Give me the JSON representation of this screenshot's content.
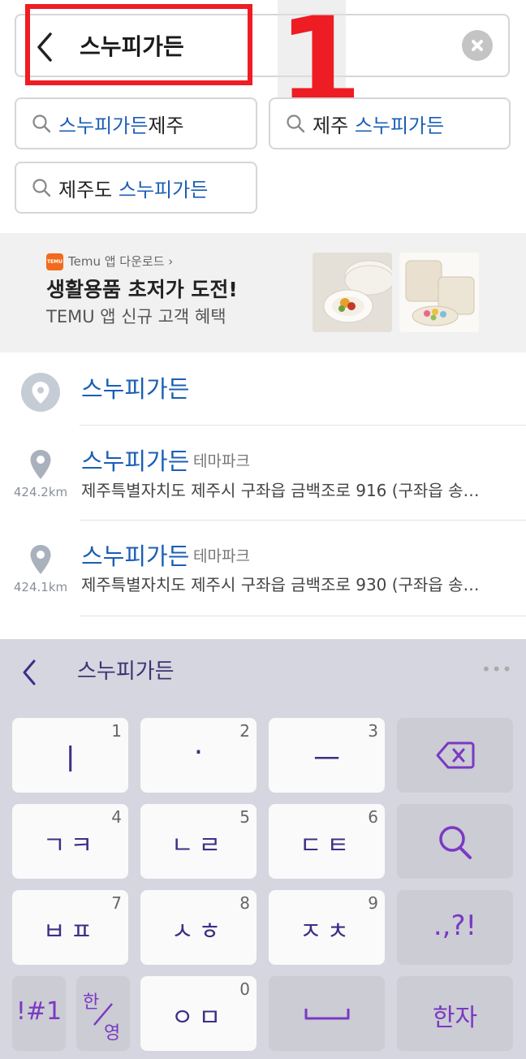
{
  "search": {
    "query": "스누피가든"
  },
  "annotation": {
    "number": "1"
  },
  "suggestions": [
    {
      "highlight": "스누피가든",
      "plain": "제주",
      "order": "hl-first"
    },
    {
      "plain": "제주",
      "highlight": "스누피가든",
      "order": "pl-first"
    },
    {
      "plain": "제주도",
      "highlight": "스누피가든",
      "order": "pl-first"
    }
  ],
  "ad": {
    "brand_link": "Temu 앱 다운로드 ›",
    "logo_text": "TEMU",
    "title": "생활용품 초저가 도전!",
    "subtitle": "TEMU 앱 신규 고객 혜택"
  },
  "results": [
    {
      "title": "스누피가든",
      "category": "",
      "address": "",
      "distance": ""
    },
    {
      "title": "스누피가든",
      "category": "테마파크",
      "address": "제주특별자치도 제주시 구좌읍 금백조로 916 (구좌읍 송…",
      "distance": "424.2km"
    },
    {
      "title": "스누피가든",
      "category": "테마파크",
      "address": "제주특별자치도 제주시 구좌읍 금백조로 930 (구좌읍 송…",
      "distance": "424.1km"
    }
  ],
  "keyboard": {
    "composing": "스누피가든",
    "more": "•••",
    "rows": [
      [
        {
          "label": "ㅣ",
          "num": "1"
        },
        {
          "label": "·",
          "num": "2"
        },
        {
          "label": "ㅡ",
          "num": "3"
        },
        {
          "label": "backspace"
        }
      ],
      [
        {
          "label": "ㄱㅋ",
          "num": "4"
        },
        {
          "label": "ㄴㄹ",
          "num": "5"
        },
        {
          "label": "ㄷㅌ",
          "num": "6"
        },
        {
          "label": "search"
        }
      ],
      [
        {
          "label": "ㅂㅍ",
          "num": "7"
        },
        {
          "label": "ㅅㅎ",
          "num": "8"
        },
        {
          "label": "ㅈㅊ",
          "num": "9"
        },
        {
          "label": ".,?!"
        }
      ],
      [
        {
          "label": "!#1"
        },
        {
          "label_top": "한",
          "label_bottom": "영"
        },
        {
          "label": "ㅇㅁ",
          "num": "0"
        },
        {
          "label": "space"
        },
        {
          "label": "한자"
        }
      ]
    ]
  },
  "colors": {
    "accent": "#1a5fb4",
    "keyboard_text": "#3d2e86",
    "annotation": "#ee1c23",
    "temu": "#f26a1b"
  }
}
